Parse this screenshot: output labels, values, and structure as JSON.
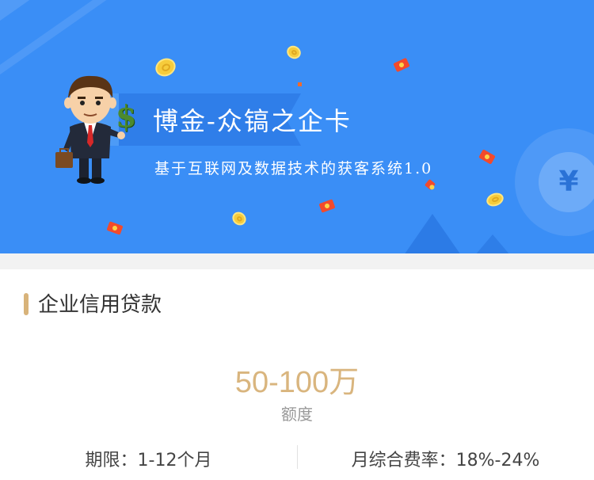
{
  "banner": {
    "title": "博金-众镐之企卡",
    "subtitle": "基于互联网及数据技术的获客系统1.0",
    "yen_symbol": "¥",
    "dollar_symbol": "$",
    "colors": {
      "background": "#3a8ef6",
      "ribbon": "#2f7ee9"
    }
  },
  "product": {
    "section_title": "企业信用贷款",
    "amount": "50-100万",
    "amount_label": "额度",
    "term": "期限：1-12个月",
    "rate": "月综合费率：18%-24%",
    "colors": {
      "accent": "#d8b37a",
      "amount": "#d9b57e"
    }
  }
}
